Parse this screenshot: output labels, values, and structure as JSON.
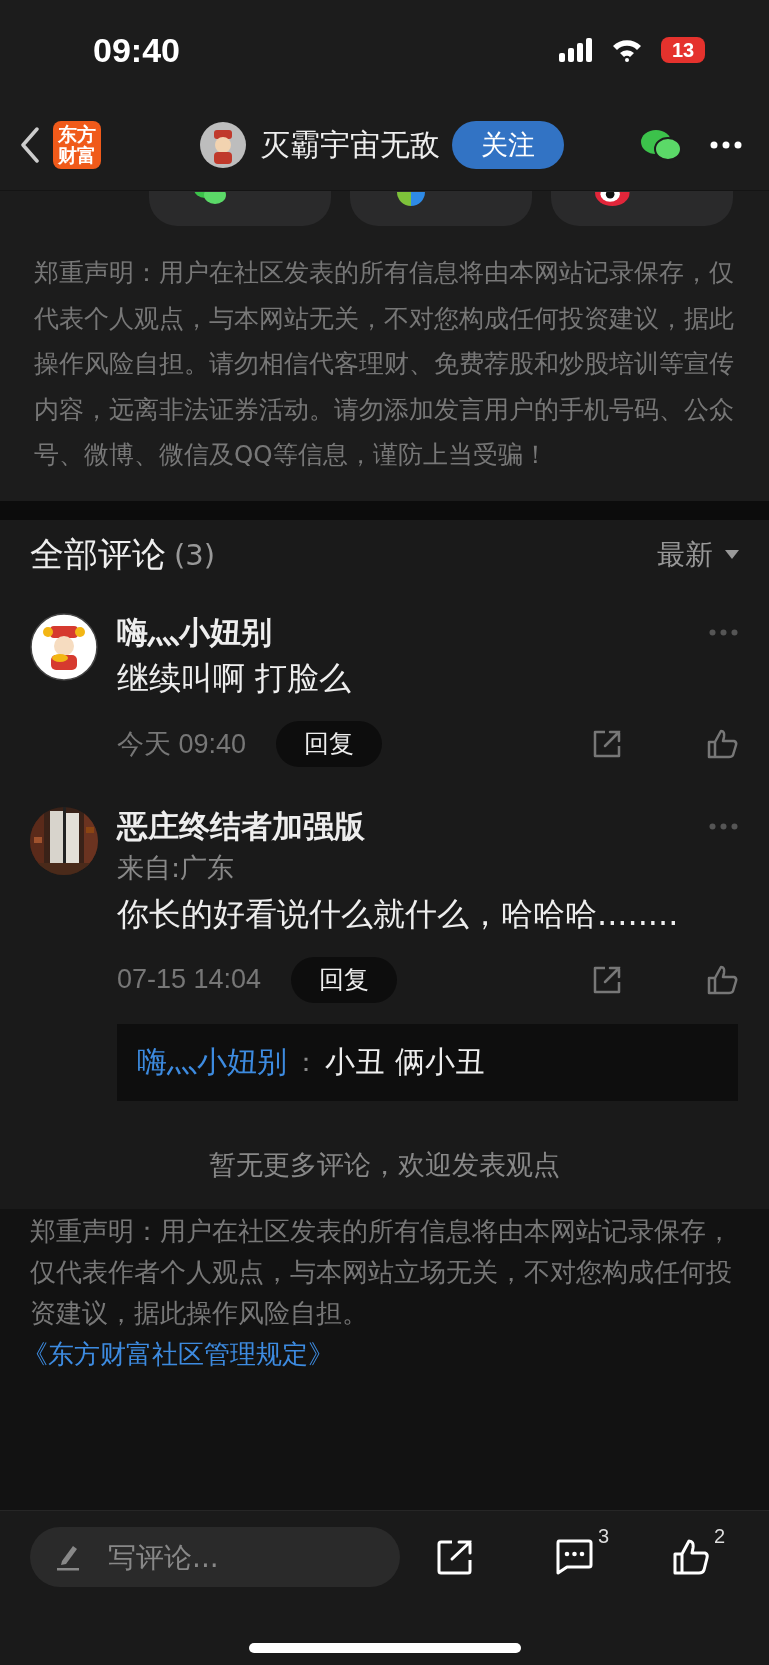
{
  "status_bar": {
    "time": "09:40",
    "battery": "13"
  },
  "header": {
    "logo": [
      "东方",
      "财富"
    ],
    "author": "灭霸宇宙无敌",
    "follow_button": "关注"
  },
  "share_options": [
    {
      "kind": "wechat"
    },
    {
      "kind": "moments"
    },
    {
      "kind": "weibo"
    }
  ],
  "disclaimer": "郑重声明：用户在社区发表的所有信息将由本网站记录保存，仅代表个人观点，与本网站无关，不对您构成任何投资建议，据此操作风险自担。请勿相信代客理财、免费荐股和炒股培训等宣传内容，远离非法证券活动。请勿添加发言用户的手机号码、公众号、微博、微信及QQ等信息，谨防上当受骗！",
  "comments_header": {
    "title": "全部评论",
    "count": "(3)",
    "sort": "最新"
  },
  "comments": [
    {
      "avatar": {
        "kind": "figure"
      },
      "name": "嗨灬小妞别",
      "text": "继续叫啊 打脸么",
      "time": "今天 09:40",
      "reply_button": "回复"
    },
    {
      "avatar": {
        "kind": "picture"
      },
      "name": "恶庄终结者加强版",
      "location": "来自:广东",
      "text": "你长的好看说什么就什么，哈哈哈........",
      "time": "07-15 14:04",
      "reply_button": "回复",
      "replies": [
        {
          "author": "嗨灬小妞别",
          "separator": "：",
          "text": "小丑 俩小丑"
        }
      ]
    }
  ],
  "no_more": "暂无更多评论，欢迎发表观点",
  "footer_note": {
    "text": "郑重声明：用户在社区发表的所有信息将由本网站记录保存，仅代表作者个人观点，与本网站立场无关，不对您构成任何投资建议，据此操作风险自担。",
    "link": "《东方财富社区管理规定》"
  },
  "bottom_bar": {
    "placeholder": "写评论...",
    "comment_count": "3",
    "like_count": "2"
  }
}
